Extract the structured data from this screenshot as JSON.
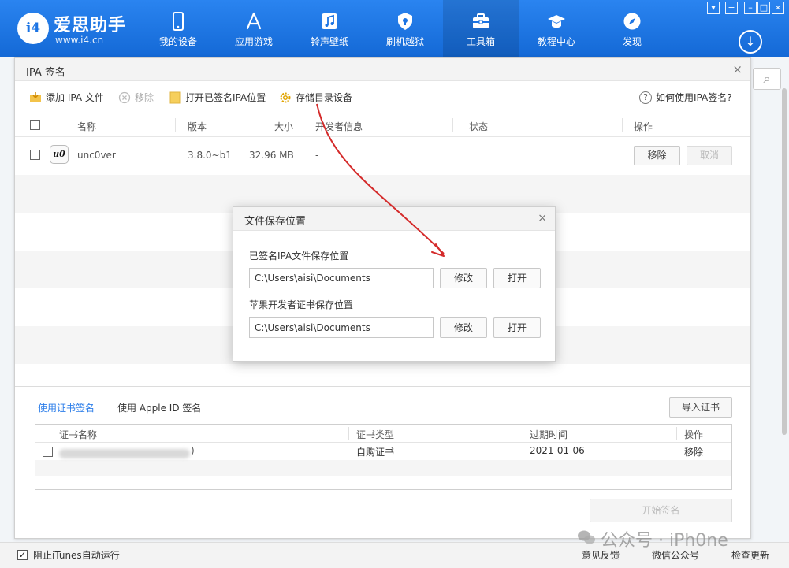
{
  "app": {
    "logo_text": "i4",
    "brand": "爱思助手",
    "url": "www.i4.cn"
  },
  "nav": [
    {
      "label": "我的设备",
      "icon": "phone-icon"
    },
    {
      "label": "应用游戏",
      "icon": "appstore-icon"
    },
    {
      "label": "铃声壁纸",
      "icon": "music-icon"
    },
    {
      "label": "刷机越狱",
      "icon": "shield-icon"
    },
    {
      "label": "工具箱",
      "icon": "toolbox-icon",
      "active": true
    },
    {
      "label": "教程中心",
      "icon": "graduation-cap-icon"
    },
    {
      "label": "发现",
      "icon": "compass-icon"
    }
  ],
  "dialog": {
    "title": "IPA 签名",
    "close": "×",
    "toolbar": {
      "add": "添加 IPA 文件",
      "remove": "移除",
      "open_signed": "打开已签名IPA位置",
      "storage_dir": "存储目录设备",
      "help": "如何使用IPA签名?"
    },
    "columns": {
      "name": "名称",
      "version": "版本",
      "size": "大小",
      "developer": "开发者信息",
      "status": "状态",
      "action": "操作"
    },
    "rows": [
      {
        "icon_text": "u0",
        "name": "unc0ver",
        "version": "3.8.0~b1",
        "size": "32.96 MB",
        "developer": "-",
        "status": "",
        "remove": "移除",
        "cancel": "取消"
      }
    ],
    "cert_tabs": {
      "cert": "使用证书签名",
      "apple_id": "使用 Apple ID 签名"
    },
    "import_cert": "导入证书",
    "cert_columns": {
      "name": "证书名称",
      "type": "证书类型",
      "expires": "过期时间",
      "action": "操作"
    },
    "cert_rows": [
      {
        "name_suffix": ")",
        "type": "自购证书",
        "expires": "2021-01-06",
        "action": "移除"
      }
    ],
    "start_sign": "开始签名"
  },
  "subdialog": {
    "title": "文件保存位置",
    "close": "×",
    "signed_label": "已签名IPA文件保存位置",
    "signed_path": "C:\\Users\\aisi\\Documents",
    "cert_label": "苹果开发者证书保存位置",
    "cert_path": "C:\\Users\\aisi\\Documents",
    "modify": "修改",
    "open": "打开"
  },
  "statusbar": {
    "block_itunes": "阻止iTunes自动运行",
    "block_itunes_checked": true,
    "feedback": "意见反馈",
    "wechat": "微信公众号",
    "update": "检查更新"
  },
  "watermark": "公众号 · iPh0ne",
  "colors": {
    "brand_blue": "#1b74e4",
    "link_blue": "#2b7de9",
    "annotation_red": "#d42a2a"
  }
}
